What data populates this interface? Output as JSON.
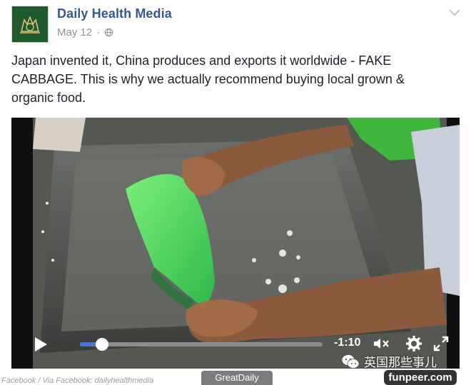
{
  "post": {
    "page_name": "Daily Health Media",
    "date": "May 12",
    "privacy_icon": "globe-icon",
    "text": "Japan invented it, China produces and exports it worldwide - FAKE CABBAGE. This is why we actually recommend buying local grown & organic food."
  },
  "video": {
    "progress": 0.09,
    "time_remaining": "-1:10",
    "icons": [
      "play-icon",
      "mute-icon",
      "settings-icon",
      "fullscreen-icon"
    ]
  },
  "watermarks": {
    "wechat_account": "英国那些事儿",
    "source_credit": "Facebook / Via Facebook: dailyhealthmedia",
    "greatdaily": "GreatDaily",
    "funpeer": "funpeer.com"
  },
  "colors": {
    "link_blue": "#365899",
    "meta_gray": "#90949c",
    "progress_blue": "#4a76d1",
    "avatar_green": "#1f5a2c"
  }
}
